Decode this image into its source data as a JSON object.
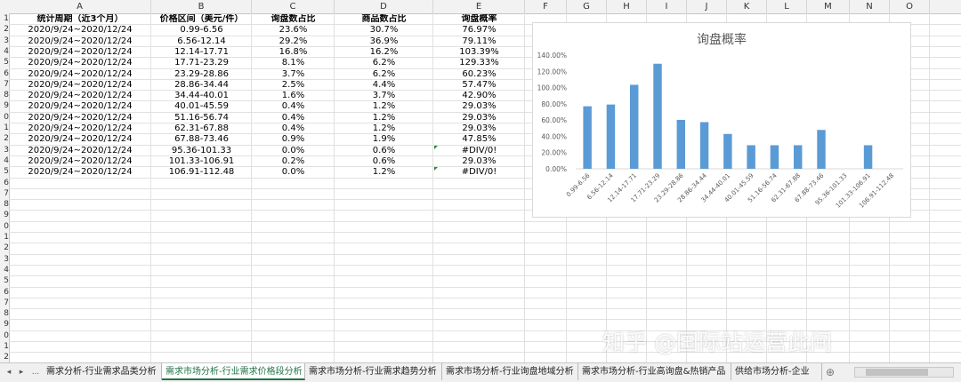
{
  "columns": [
    "A",
    "B",
    "C",
    "D",
    "E",
    "F",
    "G",
    "H",
    "I",
    "J",
    "K",
    "L",
    "M",
    "N",
    "O"
  ],
  "row_numbers": [
    "1",
    "2",
    "3",
    "4",
    "5",
    "6",
    "7",
    "8",
    "9",
    "0",
    "1",
    "2",
    "3",
    "4",
    "5",
    "6",
    "7",
    "8",
    "9",
    "0",
    "1",
    "2",
    "3",
    "4",
    "5",
    "6",
    "7",
    "8",
    "9",
    "0",
    "1",
    "2"
  ],
  "table": {
    "headers": [
      "统计周期（近3个月）",
      "价格区间（美元/件）",
      "询盘数占比",
      "商品数占比",
      "询盘概率"
    ],
    "rows": [
      [
        "2020/9/24~2020/12/24",
        "0.99-6.56",
        "23.6%",
        "30.7%",
        "76.97%"
      ],
      [
        "2020/9/24~2020/12/24",
        "6.56-12.14",
        "29.2%",
        "36.9%",
        "79.11%"
      ],
      [
        "2020/9/24~2020/12/24",
        "12.14-17.71",
        "16.8%",
        "16.2%",
        "103.39%"
      ],
      [
        "2020/9/24~2020/12/24",
        "17.71-23.29",
        "8.1%",
        "6.2%",
        "129.33%"
      ],
      [
        "2020/9/24~2020/12/24",
        "23.29-28.86",
        "3.7%",
        "6.2%",
        "60.23%"
      ],
      [
        "2020/9/24~2020/12/24",
        "28.86-34.44",
        "2.5%",
        "4.4%",
        "57.47%"
      ],
      [
        "2020/9/24~2020/12/24",
        "34.44-40.01",
        "1.6%",
        "3.7%",
        "42.90%"
      ],
      [
        "2020/9/24~2020/12/24",
        "40.01-45.59",
        "0.4%",
        "1.2%",
        "29.03%"
      ],
      [
        "2020/9/24~2020/12/24",
        "51.16-56.74",
        "0.4%",
        "1.2%",
        "29.03%"
      ],
      [
        "2020/9/24~2020/12/24",
        "62.31-67.88",
        "0.4%",
        "1.2%",
        "29.03%"
      ],
      [
        "2020/9/24~2020/12/24",
        "67.88-73.46",
        "0.9%",
        "1.9%",
        "47.85%"
      ],
      [
        "2020/9/24~2020/12/24",
        "95.36-101.33",
        "0.0%",
        "0.6%",
        "#DIV/0!"
      ],
      [
        "2020/9/24~2020/12/24",
        "101.33-106.91",
        "0.2%",
        "0.6%",
        "29.03%"
      ],
      [
        "2020/9/24~2020/12/24",
        "106.91-112.48",
        "0.0%",
        "1.2%",
        "#DIV/0!"
      ]
    ]
  },
  "chart_data": {
    "type": "bar",
    "title": "询盘概率",
    "categories": [
      "0.99-6.56",
      "6.56-12.14",
      "12.14-17.71",
      "17.71-23.29",
      "23.29-28.86",
      "28.86-34.44",
      "34.44-40.01",
      "40.01-45.59",
      "51.16-56.74",
      "62.31-67.88",
      "67.88-73.46",
      "95.36-101.33",
      "101.33-106.91",
      "106.91-112.48"
    ],
    "values": [
      76.97,
      79.11,
      103.39,
      129.33,
      60.23,
      57.47,
      42.9,
      29.03,
      29.03,
      29.03,
      47.85,
      0,
      29.03,
      0
    ],
    "yticks": [
      "0.00%",
      "20.00%",
      "40.00%",
      "60.00%",
      "80.00%",
      "100.00%",
      "120.00%",
      "140.00%"
    ],
    "ylim": [
      0,
      140
    ],
    "bar_color": "#5b9bd5",
    "grid": false
  },
  "sheet_tabs": {
    "nav_prev": "◂",
    "nav_next": "▸",
    "more": "...",
    "tabs": [
      "需求分析-行业需求品类分析",
      "需求市场分析-行业需求价格段分析",
      "需求市场分析-行业需求趋势分析",
      "需求市场分析-行业询盘地域分析",
      "需求市场分析-行业高询盘&热销产品",
      "供给市场分析-企业"
    ],
    "active_index": 1,
    "add_label": "⊕"
  },
  "watermark": "知乎 @国际站运营此间",
  "colors": {
    "accent": "#217346",
    "grid": "#e1e1e1",
    "header_bg": "#f2f2f2"
  }
}
